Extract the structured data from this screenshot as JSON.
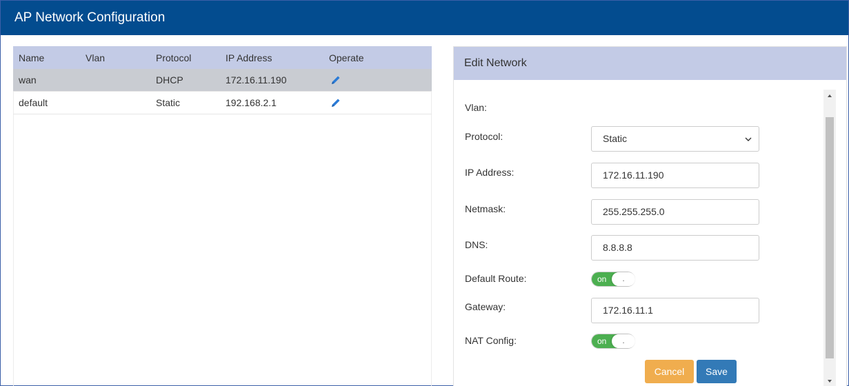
{
  "window": {
    "title": "AP Network Configuration"
  },
  "table": {
    "headers": {
      "name": "Name",
      "vlan": "Vlan",
      "protocol": "Protocol",
      "ip": "IP Address",
      "operate": "Operate"
    },
    "rows": [
      {
        "name": "wan",
        "vlan": "",
        "protocol": "DHCP",
        "ip": "172.16.11.190",
        "operate_icon": "pencil-icon",
        "selected": true
      },
      {
        "name": "default",
        "vlan": "",
        "protocol": "Static",
        "ip": "192.168.2.1",
        "operate_icon": "pencil-icon",
        "selected": false
      }
    ]
  },
  "edit": {
    "title": "Edit Network",
    "labels": {
      "vlan": "Vlan:",
      "protocol": "Protocol:",
      "ip": "IP Address:",
      "netmask": "Netmask:",
      "dns": "DNS:",
      "default_route": "Default Route:",
      "gateway": "Gateway:",
      "nat": "NAT Config:"
    },
    "values": {
      "protocol": "Static",
      "ip": "172.16.11.190",
      "netmask": "255.255.255.0",
      "dns": "8.8.8.8",
      "gateway": "172.16.11.1"
    },
    "toggles": {
      "default_route": {
        "on_label": "on",
        "knob_label": ".",
        "state": true
      },
      "nat": {
        "on_label": "on",
        "knob_label": ".",
        "state": true
      }
    },
    "buttons": {
      "cancel": "Cancel",
      "save": "Save"
    }
  },
  "colors": {
    "titlebar": "#034c8f",
    "header_bg": "#c3cbe6",
    "selected_row": "#c9ccd2",
    "toggle_on": "#4caf50",
    "cancel": "#f0ad4e",
    "save": "#337ab7",
    "pencil": "#2b7bd6"
  }
}
